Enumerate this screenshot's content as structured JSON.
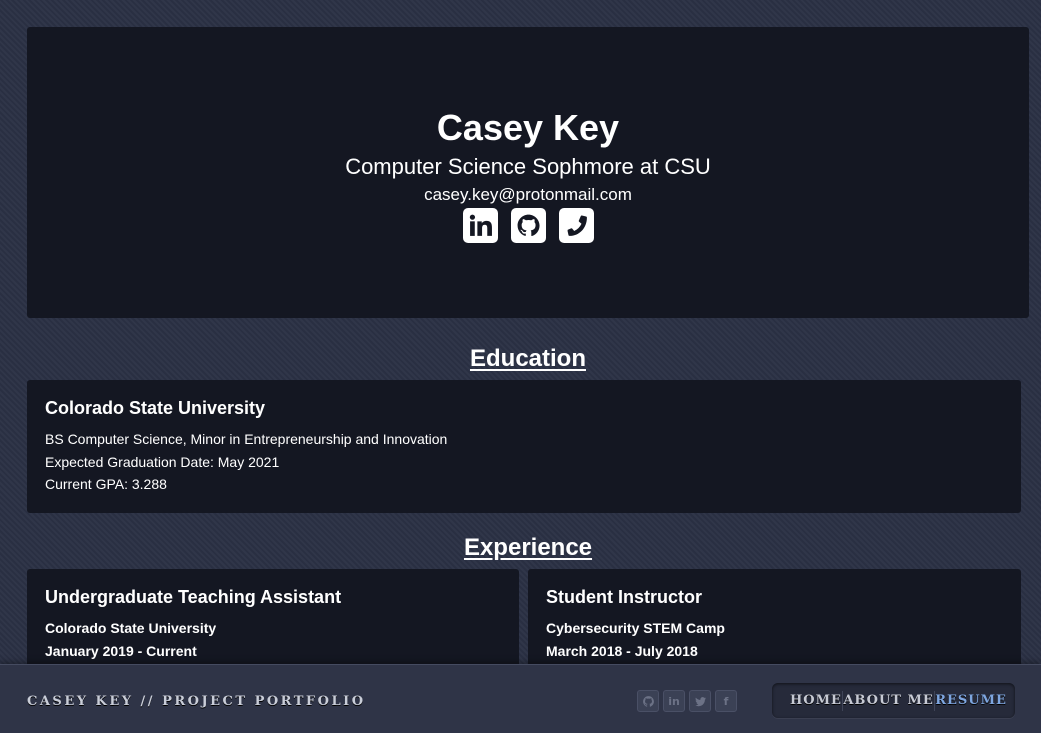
{
  "hero": {
    "name": "Casey Key",
    "tagline": "Computer Science Sophmore at CSU",
    "email": "casey.key@protonmail.com",
    "socials": [
      {
        "icon": "linkedin-icon"
      },
      {
        "icon": "github-icon"
      },
      {
        "icon": "phone-icon"
      }
    ]
  },
  "education": {
    "heading": "Education",
    "school": "Colorado State University",
    "lines": [
      "BS Computer Science, Minor in Entrepreneurship and Innovation",
      "Expected Graduation Date: May 2021",
      "Current GPA: 3.288"
    ]
  },
  "experience": {
    "heading": "Experience",
    "items": [
      {
        "title": "Undergraduate Teaching Assistant",
        "org": "Colorado State University",
        "dates": "January 2019 - Current"
      },
      {
        "title": "Student Instructor",
        "org": "Cybersecurity STEM Camp",
        "dates": "March 2018 - July 2018"
      }
    ]
  },
  "footer": {
    "brand": "CASEY KEY // PROJECT PORTFOLIO",
    "socials": [
      {
        "icon": "github-icon"
      },
      {
        "icon": "linkedin-icon",
        "glyph": "in"
      },
      {
        "icon": "twitter-icon"
      },
      {
        "icon": "facebook-icon",
        "glyph": "f"
      }
    ],
    "nav": [
      {
        "label": "HOME",
        "active": false
      },
      {
        "label": "ABOUT ME",
        "active": false
      },
      {
        "label": "RESUME",
        "active": true
      }
    ],
    "active_color": "#7ea6e0"
  }
}
